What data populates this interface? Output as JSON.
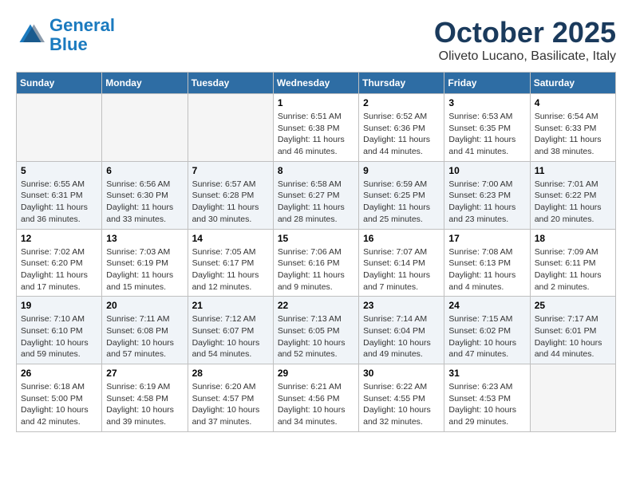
{
  "header": {
    "logo_line1": "General",
    "logo_line2": "Blue",
    "month": "October 2025",
    "location": "Oliveto Lucano, Basilicate, Italy"
  },
  "weekdays": [
    "Sunday",
    "Monday",
    "Tuesday",
    "Wednesday",
    "Thursday",
    "Friday",
    "Saturday"
  ],
  "weeks": [
    [
      {
        "day": "",
        "info": ""
      },
      {
        "day": "",
        "info": ""
      },
      {
        "day": "",
        "info": ""
      },
      {
        "day": "1",
        "info": "Sunrise: 6:51 AM\nSunset: 6:38 PM\nDaylight: 11 hours\nand 46 minutes."
      },
      {
        "day": "2",
        "info": "Sunrise: 6:52 AM\nSunset: 6:36 PM\nDaylight: 11 hours\nand 44 minutes."
      },
      {
        "day": "3",
        "info": "Sunrise: 6:53 AM\nSunset: 6:35 PM\nDaylight: 11 hours\nand 41 minutes."
      },
      {
        "day": "4",
        "info": "Sunrise: 6:54 AM\nSunset: 6:33 PM\nDaylight: 11 hours\nand 38 minutes."
      }
    ],
    [
      {
        "day": "5",
        "info": "Sunrise: 6:55 AM\nSunset: 6:31 PM\nDaylight: 11 hours\nand 36 minutes."
      },
      {
        "day": "6",
        "info": "Sunrise: 6:56 AM\nSunset: 6:30 PM\nDaylight: 11 hours\nand 33 minutes."
      },
      {
        "day": "7",
        "info": "Sunrise: 6:57 AM\nSunset: 6:28 PM\nDaylight: 11 hours\nand 30 minutes."
      },
      {
        "day": "8",
        "info": "Sunrise: 6:58 AM\nSunset: 6:27 PM\nDaylight: 11 hours\nand 28 minutes."
      },
      {
        "day": "9",
        "info": "Sunrise: 6:59 AM\nSunset: 6:25 PM\nDaylight: 11 hours\nand 25 minutes."
      },
      {
        "day": "10",
        "info": "Sunrise: 7:00 AM\nSunset: 6:23 PM\nDaylight: 11 hours\nand 23 minutes."
      },
      {
        "day": "11",
        "info": "Sunrise: 7:01 AM\nSunset: 6:22 PM\nDaylight: 11 hours\nand 20 minutes."
      }
    ],
    [
      {
        "day": "12",
        "info": "Sunrise: 7:02 AM\nSunset: 6:20 PM\nDaylight: 11 hours\nand 17 minutes."
      },
      {
        "day": "13",
        "info": "Sunrise: 7:03 AM\nSunset: 6:19 PM\nDaylight: 11 hours\nand 15 minutes."
      },
      {
        "day": "14",
        "info": "Sunrise: 7:05 AM\nSunset: 6:17 PM\nDaylight: 11 hours\nand 12 minutes."
      },
      {
        "day": "15",
        "info": "Sunrise: 7:06 AM\nSunset: 6:16 PM\nDaylight: 11 hours\nand 9 minutes."
      },
      {
        "day": "16",
        "info": "Sunrise: 7:07 AM\nSunset: 6:14 PM\nDaylight: 11 hours\nand 7 minutes."
      },
      {
        "day": "17",
        "info": "Sunrise: 7:08 AM\nSunset: 6:13 PM\nDaylight: 11 hours\nand 4 minutes."
      },
      {
        "day": "18",
        "info": "Sunrise: 7:09 AM\nSunset: 6:11 PM\nDaylight: 11 hours\nand 2 minutes."
      }
    ],
    [
      {
        "day": "19",
        "info": "Sunrise: 7:10 AM\nSunset: 6:10 PM\nDaylight: 10 hours\nand 59 minutes."
      },
      {
        "day": "20",
        "info": "Sunrise: 7:11 AM\nSunset: 6:08 PM\nDaylight: 10 hours\nand 57 minutes."
      },
      {
        "day": "21",
        "info": "Sunrise: 7:12 AM\nSunset: 6:07 PM\nDaylight: 10 hours\nand 54 minutes."
      },
      {
        "day": "22",
        "info": "Sunrise: 7:13 AM\nSunset: 6:05 PM\nDaylight: 10 hours\nand 52 minutes."
      },
      {
        "day": "23",
        "info": "Sunrise: 7:14 AM\nSunset: 6:04 PM\nDaylight: 10 hours\nand 49 minutes."
      },
      {
        "day": "24",
        "info": "Sunrise: 7:15 AM\nSunset: 6:02 PM\nDaylight: 10 hours\nand 47 minutes."
      },
      {
        "day": "25",
        "info": "Sunrise: 7:17 AM\nSunset: 6:01 PM\nDaylight: 10 hours\nand 44 minutes."
      }
    ],
    [
      {
        "day": "26",
        "info": "Sunrise: 6:18 AM\nSunset: 5:00 PM\nDaylight: 10 hours\nand 42 minutes."
      },
      {
        "day": "27",
        "info": "Sunrise: 6:19 AM\nSunset: 4:58 PM\nDaylight: 10 hours\nand 39 minutes."
      },
      {
        "day": "28",
        "info": "Sunrise: 6:20 AM\nSunset: 4:57 PM\nDaylight: 10 hours\nand 37 minutes."
      },
      {
        "day": "29",
        "info": "Sunrise: 6:21 AM\nSunset: 4:56 PM\nDaylight: 10 hours\nand 34 minutes."
      },
      {
        "day": "30",
        "info": "Sunrise: 6:22 AM\nSunset: 4:55 PM\nDaylight: 10 hours\nand 32 minutes."
      },
      {
        "day": "31",
        "info": "Sunrise: 6:23 AM\nSunset: 4:53 PM\nDaylight: 10 hours\nand 29 minutes."
      },
      {
        "day": "",
        "info": ""
      }
    ]
  ]
}
